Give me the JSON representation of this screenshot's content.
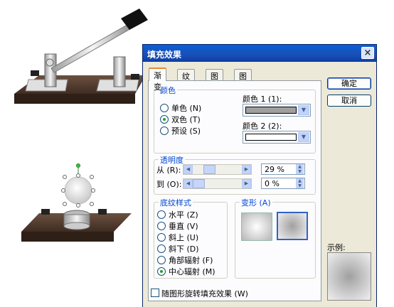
{
  "dialog": {
    "title": "填充效果",
    "close_label": "×",
    "tabs": [
      "渐变",
      "纹理",
      "图案",
      "图片"
    ],
    "ok_label": "确定",
    "cancel_label": "取消",
    "sample_label": "示例:",
    "rotate_label": "随图形旋转填充效果 (W)"
  },
  "colors_group": {
    "legend": "颜色",
    "options": [
      "单色 (N)",
      "双色 (T)",
      "预设 (S)"
    ],
    "selected": 1,
    "color1_label": "颜色 1 (1):",
    "color2_label": "颜色 2 (2):",
    "color1": "#a0a0a0",
    "color2": "#ffffff"
  },
  "transparency_group": {
    "legend": "透明度",
    "from_label": "从 (R):",
    "to_label": "到 (O):",
    "from_value": "29 %",
    "to_value": "0 %",
    "from_fraction": 0.29,
    "to_fraction": 0.0
  },
  "shading_group": {
    "legend": "底纹样式",
    "options": [
      "水平 (Z)",
      "垂直 (V)",
      "斜上 (U)",
      "斜下 (D)",
      "角部辐射 (F)",
      "中心辐射 (M)"
    ],
    "selected": 5
  },
  "variants_group": {
    "legend": "变形 (A)"
  },
  "accent_color": "#0046d5",
  "title_color": "#0a5fd6"
}
